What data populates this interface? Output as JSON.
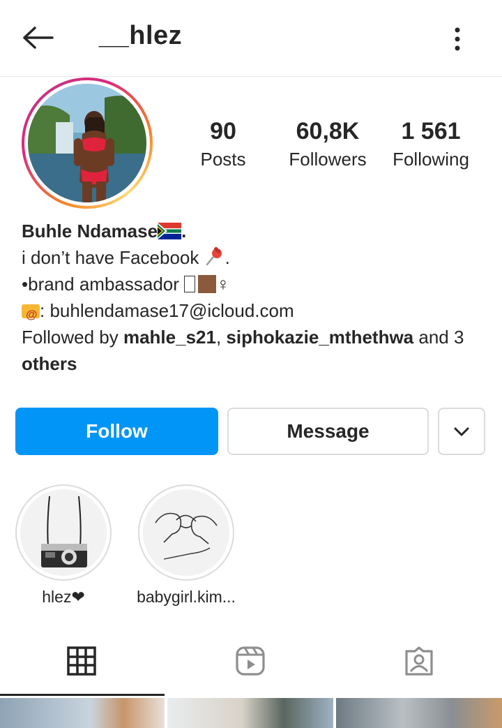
{
  "header": {
    "username": "__hlez"
  },
  "stats": {
    "posts_count": "90",
    "posts_label": "Posts",
    "followers_count": "60,8K",
    "followers_label": "Followers",
    "following_count": "1 561",
    "following_label": "Following"
  },
  "bio": {
    "name": "Buhle  Ndamase",
    "name_suffix": ".",
    "line1": "i don’t have Facebook ",
    "line1_suffix": ".",
    "line2": "•brand ambassador ",
    "line2_suffix": "♀",
    "email_prefix": ":  ",
    "email": "buhlendamase17@icloud.com",
    "followed_by_prefix": "Followed by ",
    "follower1": "mahle_s21",
    "separator": ", ",
    "follower2": "siphokazie_mthethwa",
    "and_text": " and 3 ",
    "others": "others"
  },
  "actions": {
    "follow_label": "Follow",
    "message_label": "Message"
  },
  "highlights": [
    {
      "label": "hlez❤"
    },
    {
      "label": "babygirl.kim..."
    }
  ],
  "tabs": [
    {
      "icon": "grid-icon",
      "active": true
    },
    {
      "icon": "reels-icon",
      "active": false
    },
    {
      "icon": "tagged-icon",
      "active": false
    }
  ],
  "colors": {
    "follow_button": "#0095f6",
    "text": "#262626",
    "border": "#dbdbdb"
  }
}
